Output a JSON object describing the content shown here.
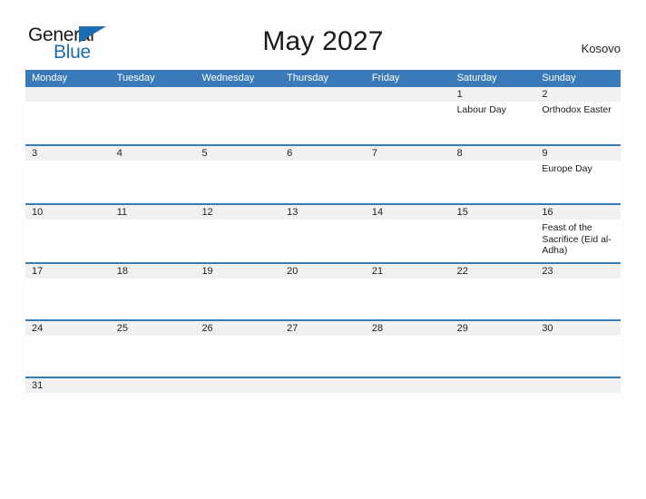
{
  "brand": {
    "name_part1": "General",
    "name_part2": "Blue",
    "flag_icon": "triangle-flag-icon",
    "accent_color": "#1b6cb0"
  },
  "header": {
    "title": "May 2027",
    "country": "Kosovo"
  },
  "colors": {
    "header_blue": "#3a7ab8",
    "row_divider_blue": "#3a7ab8",
    "date_strip_gray": "#f1f1f1",
    "text_dark": "#1a1a1a",
    "page_background": "#fdfdfd"
  },
  "weekdays": [
    "Monday",
    "Tuesday",
    "Wednesday",
    "Thursday",
    "Friday",
    "Saturday",
    "Sunday"
  ],
  "weeks": [
    {
      "size": "h-tall",
      "days": [
        {
          "num": "",
          "events": []
        },
        {
          "num": "",
          "events": []
        },
        {
          "num": "",
          "events": []
        },
        {
          "num": "",
          "events": []
        },
        {
          "num": "",
          "events": []
        },
        {
          "num": "1",
          "events": [
            "Labour Day"
          ]
        },
        {
          "num": "2",
          "events": [
            "Orthodox Easter"
          ]
        }
      ]
    },
    {
      "size": "h-mid",
      "days": [
        {
          "num": "3",
          "events": []
        },
        {
          "num": "4",
          "events": []
        },
        {
          "num": "5",
          "events": []
        },
        {
          "num": "6",
          "events": []
        },
        {
          "num": "7",
          "events": []
        },
        {
          "num": "8",
          "events": []
        },
        {
          "num": "9",
          "events": [
            "Europe Day"
          ]
        }
      ]
    },
    {
      "size": "h-mid",
      "days": [
        {
          "num": "10",
          "events": []
        },
        {
          "num": "11",
          "events": []
        },
        {
          "num": "12",
          "events": []
        },
        {
          "num": "13",
          "events": []
        },
        {
          "num": "14",
          "events": []
        },
        {
          "num": "15",
          "events": []
        },
        {
          "num": "16",
          "events": [
            "Feast of the Sacrifice (Eid al-Adha)"
          ]
        }
      ]
    },
    {
      "size": "h-short",
      "days": [
        {
          "num": "17",
          "events": []
        },
        {
          "num": "18",
          "events": []
        },
        {
          "num": "19",
          "events": []
        },
        {
          "num": "20",
          "events": []
        },
        {
          "num": "21",
          "events": []
        },
        {
          "num": "22",
          "events": []
        },
        {
          "num": "23",
          "events": []
        }
      ]
    },
    {
      "size": "h-short",
      "days": [
        {
          "num": "24",
          "events": []
        },
        {
          "num": "25",
          "events": []
        },
        {
          "num": "26",
          "events": []
        },
        {
          "num": "27",
          "events": []
        },
        {
          "num": "28",
          "events": []
        },
        {
          "num": "29",
          "events": []
        },
        {
          "num": "30",
          "events": []
        }
      ]
    },
    {
      "size": "h-last",
      "days": [
        {
          "num": "31",
          "events": []
        },
        {
          "num": "",
          "events": []
        },
        {
          "num": "",
          "events": []
        },
        {
          "num": "",
          "events": []
        },
        {
          "num": "",
          "events": []
        },
        {
          "num": "",
          "events": []
        },
        {
          "num": "",
          "events": []
        }
      ]
    }
  ]
}
